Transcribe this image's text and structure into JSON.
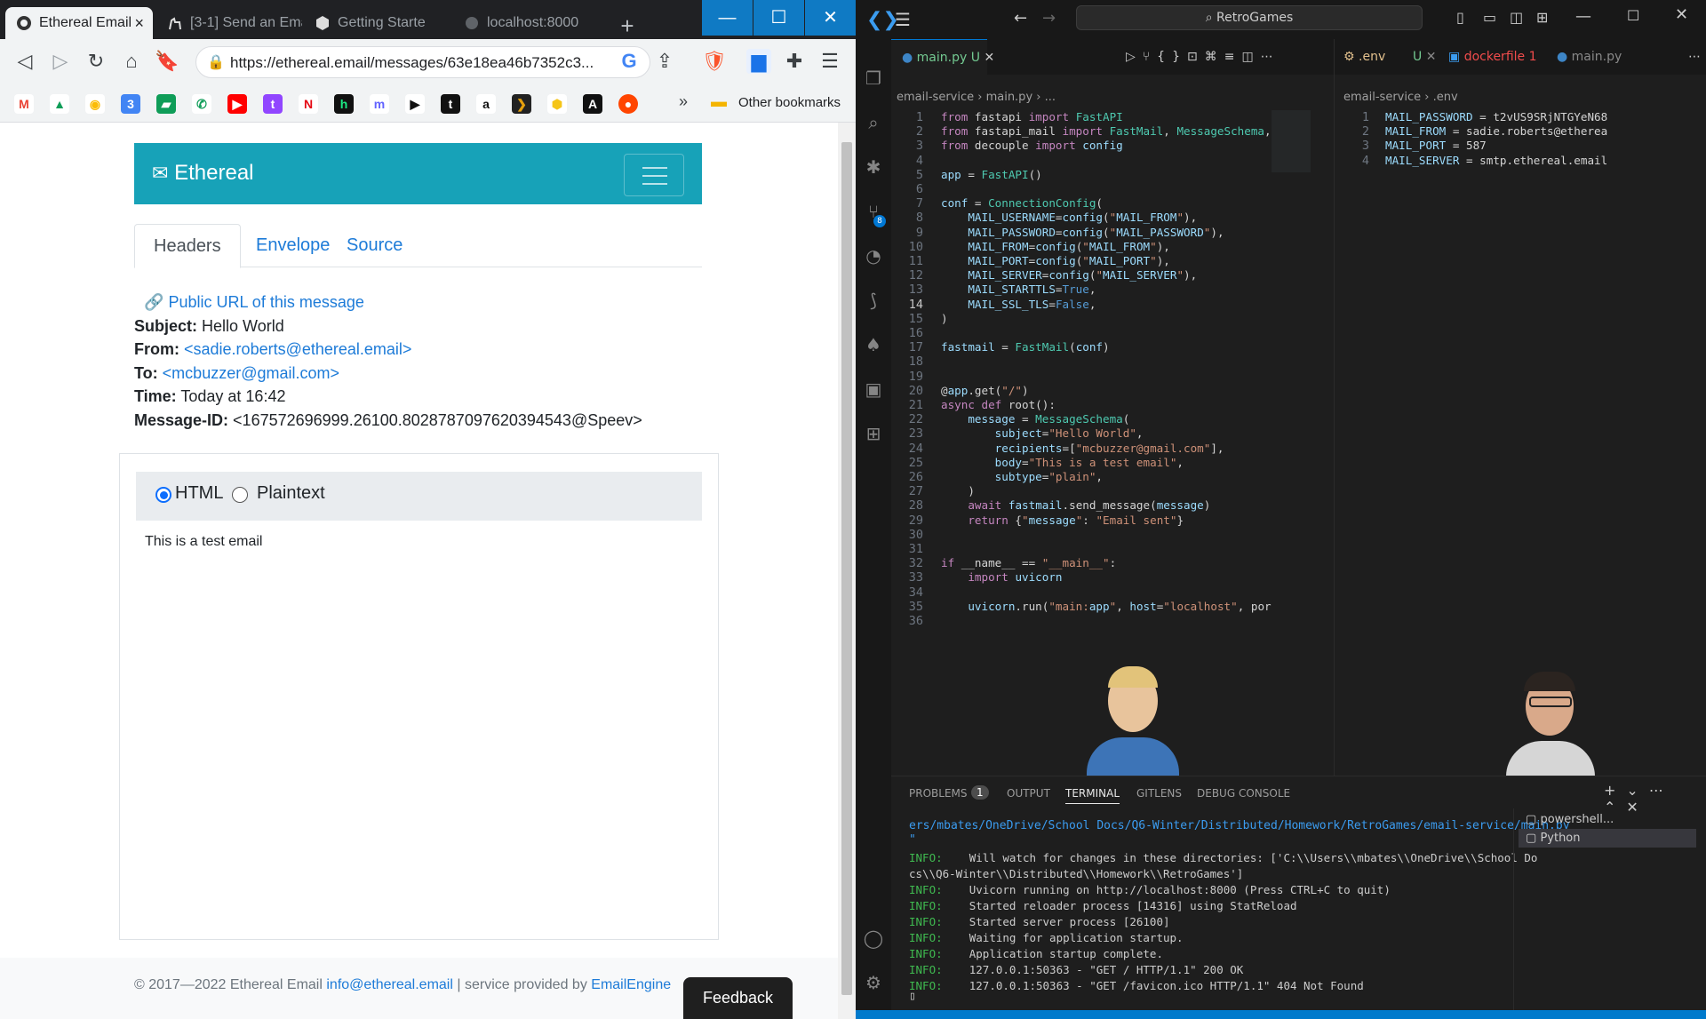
{
  "browser": {
    "tabs": [
      {
        "title": "Ethereal Email",
        "active": true
      },
      {
        "title": "[3-1] Send an Ema",
        "active": false
      },
      {
        "title": "Getting Starte",
        "active": false
      },
      {
        "title": "localhost:8000",
        "active": false
      }
    ],
    "new_tab_symbol": "+",
    "window_controls": {
      "minimize": "—",
      "maximize": "☐",
      "close": "✕"
    },
    "url": "https://ethereal.email/messages/63e18ea46b7352c3...",
    "bookmarks_overflow": "»",
    "other_bookmarks": "Other bookmarks",
    "bookmark_icons": [
      "gmail-icon",
      "drive-icon",
      "chrome-icon",
      "calendar-icon",
      "chat-icon",
      "phone-icon",
      "youtube-icon",
      "twitch-icon",
      "netflix-icon",
      "hulu-icon",
      "mastodon-icon",
      "play-icon",
      "tumblr-icon",
      "amazon-icon",
      "plex-icon",
      "bitwarden-icon",
      "a-icon",
      "reddit-icon"
    ]
  },
  "ethereal": {
    "brand": "Ethereal",
    "tabs": [
      "Headers",
      "Envelope",
      "Source"
    ],
    "public_url": "Public URL of this message",
    "subject_label": "Subject:",
    "subject": "Hello World",
    "from_label": "From:",
    "from": "<sadie.roberts@ethereal.email>",
    "to_label": "To:",
    "to": "<mcbuzzer@gmail.com>",
    "time_label": "Time:",
    "time": "Today at 16:42",
    "msgid_label": "Message-ID:",
    "msgid": "<167572696999.26100.8028787097620394543@Speev>",
    "format_html": "HTML",
    "format_plain": "Plaintext",
    "body": "This is a test email",
    "footer_copyright": "© 2017—2022 Ethereal Email",
    "footer_email": "info@ethereal.email",
    "footer_sep": "| service provided by",
    "footer_engine": "EmailEngine",
    "feedback": "Feedback"
  },
  "vscode": {
    "search": "RetroGames",
    "tab_main": "main.py",
    "tab_main_status": "U",
    "tab_env": ".env",
    "tab_env_status": "U",
    "tab_docker": "dockerfile 1",
    "tab_main2": "main.py",
    "crumb_left": "email-service › main.py › ...",
    "crumb_right": "email-service › .env",
    "code": [
      "from fastapi import FastAPI",
      "from fastapi_mail import FastMail, MessageSchema,",
      "from decouple import config",
      "",
      "app = FastAPI()",
      "",
      "conf = ConnectionConfig(",
      "    MAIL_USERNAME=config(\"MAIL_FROM\"),",
      "    MAIL_PASSWORD=config(\"MAIL_PASSWORD\"),",
      "    MAIL_FROM=config(\"MAIL_FROM\"),",
      "    MAIL_PORT=config(\"MAIL_PORT\"),",
      "    MAIL_SERVER=config(\"MAIL_SERVER\"),",
      "    MAIL_STARTTLS=True,",
      "    MAIL_SSL_TLS=False,",
      ")",
      "",
      "fastmail = FastMail(conf)",
      "",
      "",
      "@app.get(\"/\")",
      "async def root():",
      "    message = MessageSchema(",
      "        subject=\"Hello World\",",
      "        recipients=[\"mcbuzzer@gmail.com\"],",
      "        body=\"This is a test email\",",
      "        subtype=\"plain\",",
      "    )",
      "    await fastmail.send_message(message)",
      "    return {\"message\": \"Email sent\"}",
      "",
      "",
      "if __name__ == \"__main__\":",
      "    import uvicorn",
      "",
      "    uvicorn.run(\"main:app\", host=\"localhost\", por",
      ""
    ],
    "env": [
      "MAIL_PASSWORD = t2vUS9SRjNTGYeN68",
      "MAIL_FROM = sadie.roberts@etherea",
      "MAIL_PORT = 587",
      "MAIL_SERVER = smtp.ethereal.email"
    ],
    "panel_tabs": [
      "PROBLEMS",
      "1",
      "OUTPUT",
      "TERMINAL",
      "GITLENS",
      "DEBUG CONSOLE"
    ],
    "terminals": [
      "powershell...",
      "Python"
    ],
    "term_path": "ers/mbates/OneDrive/School Docs/Q6-Winter/Distributed/Homework/RetroGames/email-service/main.py",
    "term_path2": "\"",
    "term": [
      {
        "tag": "INFO:",
        "text": "    Will watch for changes in these directories: ['C:\\\\Users\\\\mbates\\\\OneDrive\\\\School Do"
      },
      {
        "tag": "",
        "text": "cs\\\\Q6-Winter\\\\Distributed\\\\Homework\\\\RetroGames']"
      },
      {
        "tag": "INFO:",
        "text": "    Uvicorn running on http://localhost:8000 (Press CTRL+C to quit)"
      },
      {
        "tag": "INFO:",
        "text": "    Started reloader process [14316] using StatReload"
      },
      {
        "tag": "INFO:",
        "text": "    Started server process [26100]"
      },
      {
        "tag": "INFO:",
        "text": "    Waiting for application startup."
      },
      {
        "tag": "INFO:",
        "text": "    Application startup complete."
      },
      {
        "tag": "INFO:",
        "text": "    127.0.0.1:50363 - \"GET / HTTP/1.1\" 200 OK"
      },
      {
        "tag": "INFO:",
        "text": "    127.0.0.1:50363 - \"GET /favicon.ico HTTP/1.1\" 404 Not Found"
      }
    ],
    "scm_badge": "8"
  }
}
